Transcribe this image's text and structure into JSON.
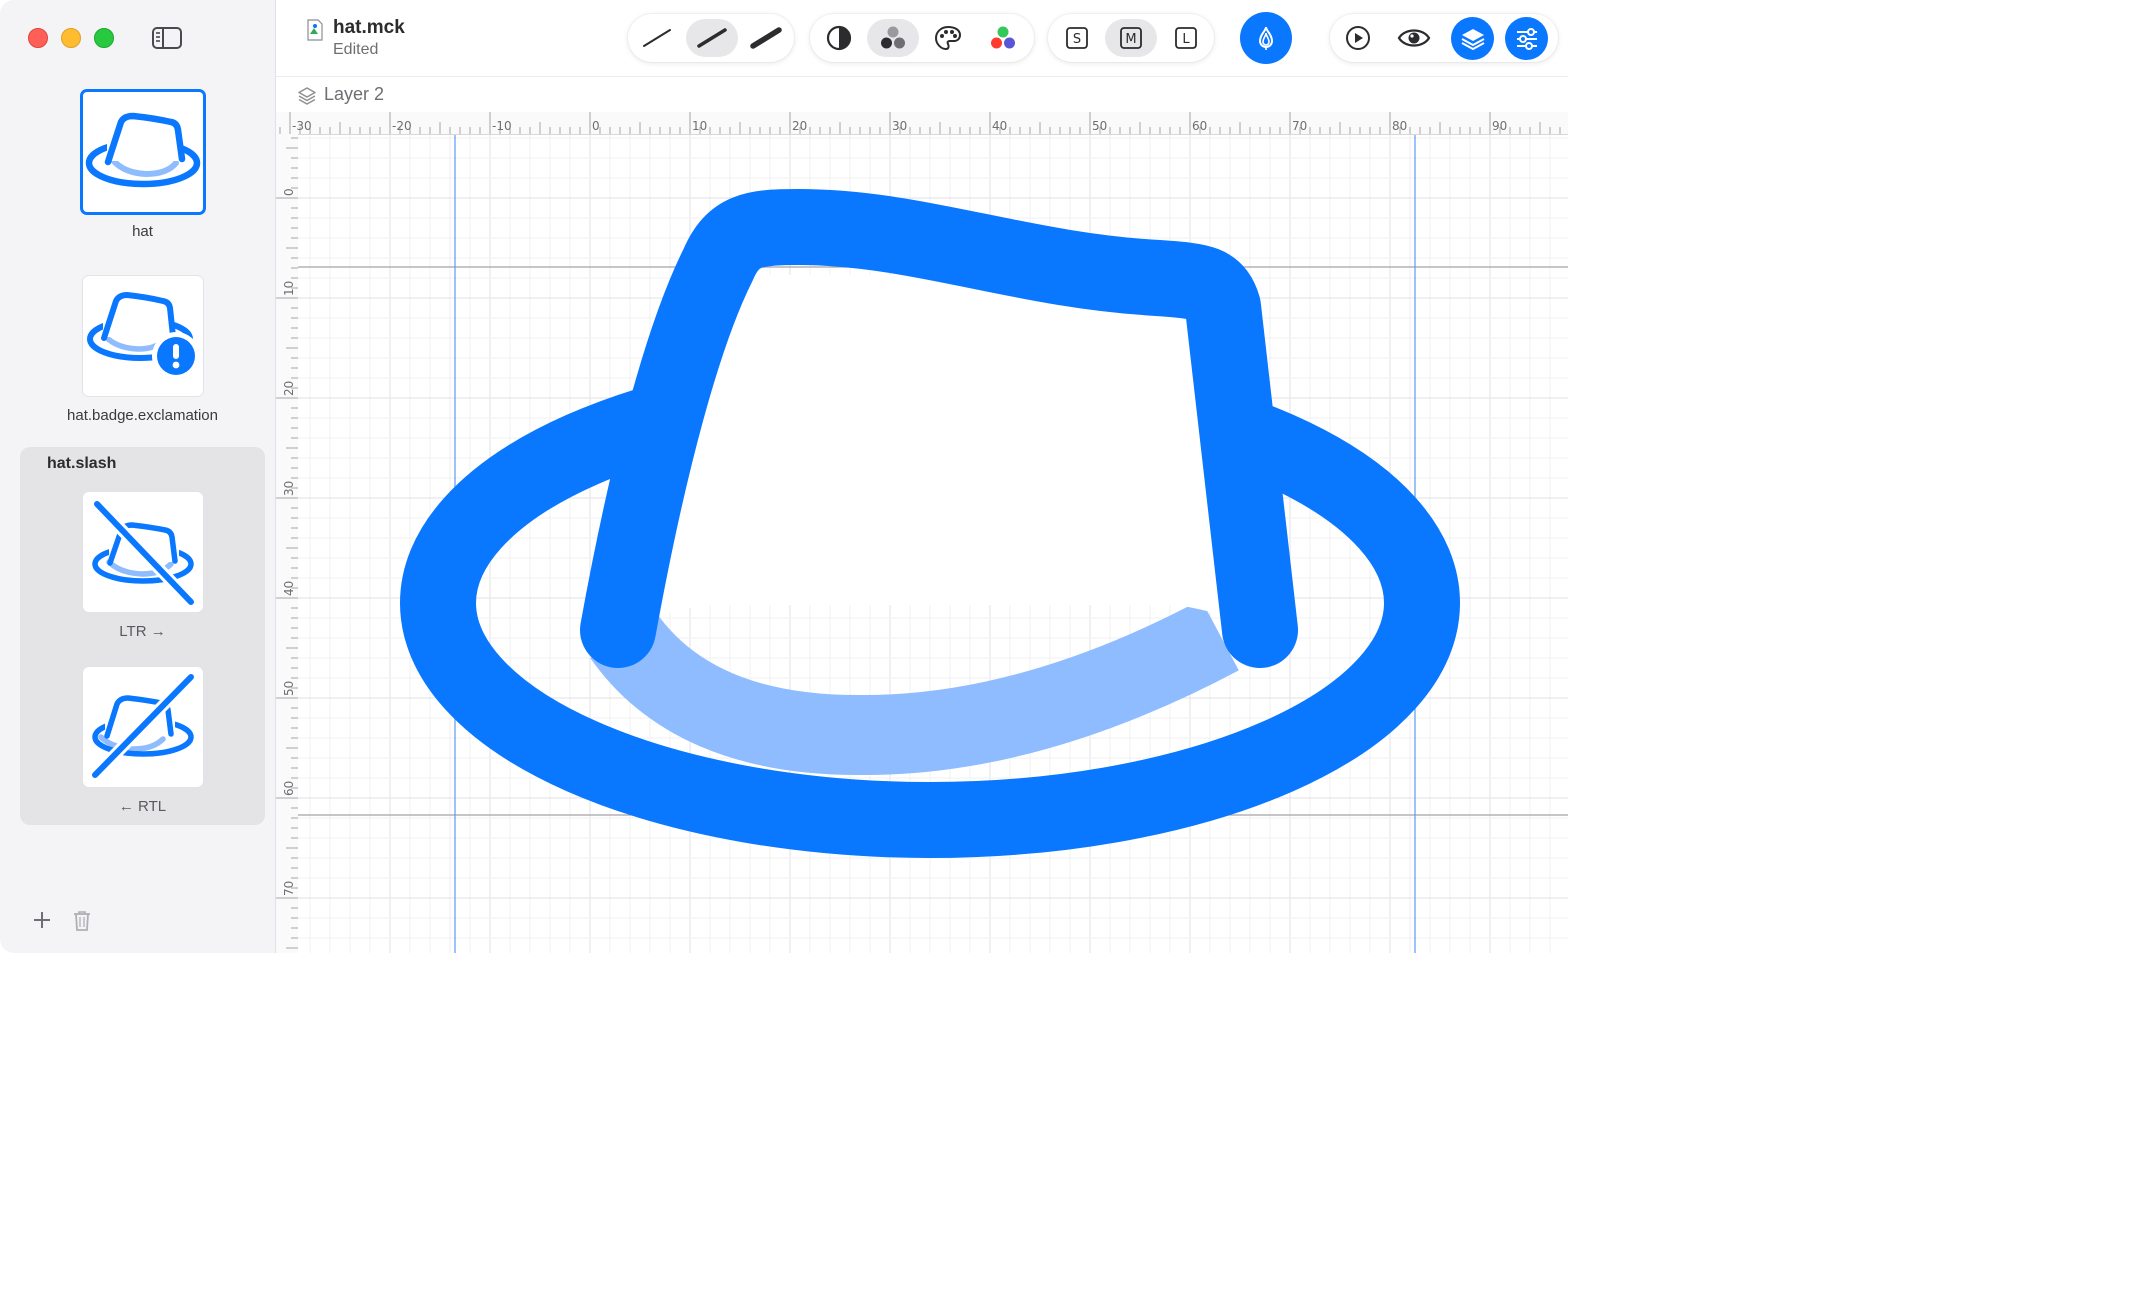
{
  "window": {
    "document_title": "hat.mck",
    "document_status": "Edited"
  },
  "sidebar": {
    "symbols": [
      {
        "name": "hat",
        "selected": true
      },
      {
        "name": "hat.badge.exclamation",
        "selected": false
      }
    ],
    "group": {
      "title": "hat.slash",
      "variants": [
        {
          "direction_label": "LTR →"
        },
        {
          "direction_label": "← RTL"
        }
      ]
    },
    "footer": {
      "add_icon": "plus-icon",
      "delete_icon": "trash-icon"
    }
  },
  "toolbar": {
    "weight_group": [
      "thin-stroke-icon",
      "regular-stroke-icon",
      "bold-stroke-icon"
    ],
    "render_group": [
      "monochrome-icon",
      "hierarchical-icon",
      "palette-icon",
      "multicolor-icon"
    ],
    "scale_group": {
      "small": "S",
      "medium": "M",
      "large": "L"
    },
    "right": [
      "onion-skin-icon",
      "play-icon",
      "preview-eye-icon",
      "layers-icon",
      "inspector-sliders-icon"
    ]
  },
  "layer": {
    "name": "Layer 2"
  },
  "rulers": {
    "horizontal_labels": [
      "-30",
      "-20",
      "-10",
      "0",
      "10",
      "20",
      "30",
      "40",
      "50",
      "60",
      "70",
      "80",
      "90"
    ],
    "vertical_labels": [
      "0",
      "10",
      "20",
      "30",
      "40",
      "50",
      "60",
      "70"
    ]
  },
  "colors": {
    "accent": "#0a77ff",
    "hat_primary": "#0a77ff",
    "hat_secondary": "#8fbcff",
    "guide_blue": "#5b9cf5",
    "guide_gray": "#9b9b9f"
  }
}
